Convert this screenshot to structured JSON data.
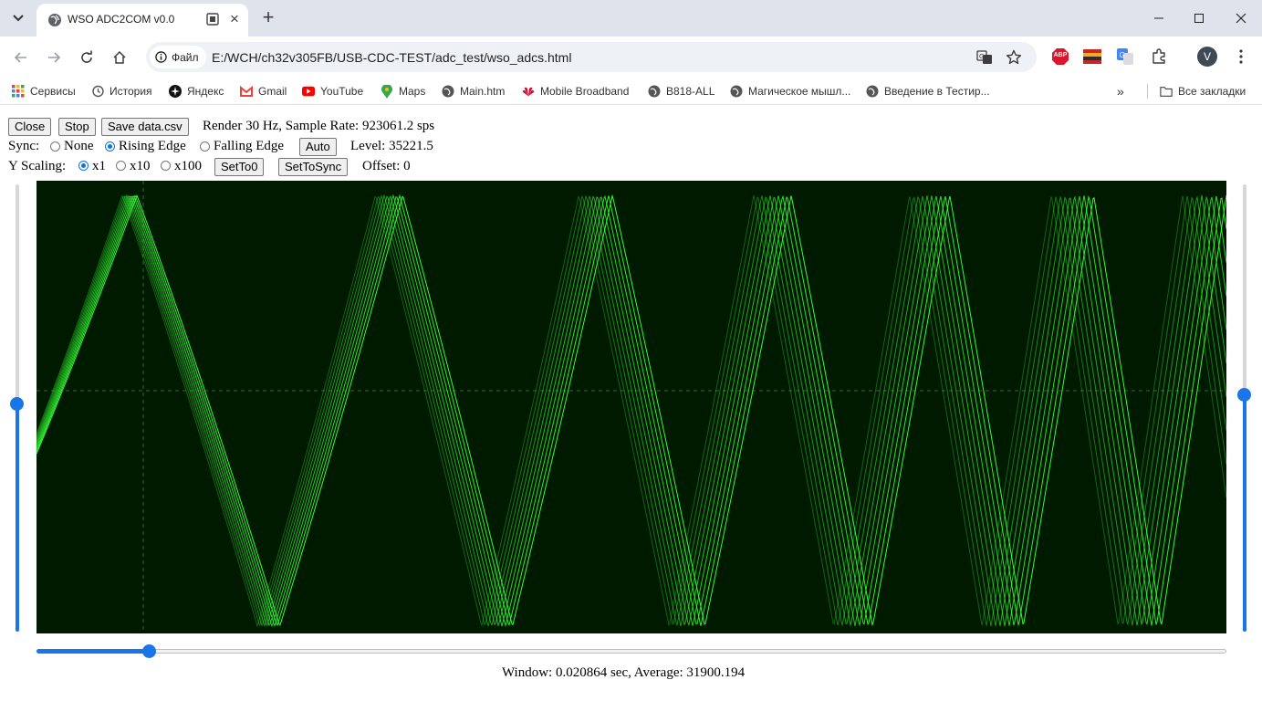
{
  "browser": {
    "tab_title": "WSO ADC2COM v0.0",
    "info_chip_label": "Файл",
    "url": "E:/WCH/ch32v305FB/USB-CDC-TEST/adc_test/wso_adcs.html",
    "profile_initial": "V",
    "abp_label": "ABP",
    "bookmarks": [
      {
        "label": "Сервисы"
      },
      {
        "label": "История"
      },
      {
        "label": "Яндекс"
      },
      {
        "label": "Gmail"
      },
      {
        "label": "YouTube"
      },
      {
        "label": "Maps"
      },
      {
        "label": "Main.htm"
      },
      {
        "label": "Mobile Broadband"
      },
      {
        "label": "B818-ALL"
      },
      {
        "label": "Магическое мышл..."
      },
      {
        "label": "Введение в Тестир..."
      }
    ],
    "all_bookmarks_label": "Все закладки"
  },
  "app": {
    "close_label": "Close",
    "stop_label": "Stop",
    "save_label": "Save data.csv",
    "render_info": "Render 30 Hz, Sample Rate: 923061.2 sps",
    "sync_label": "Sync:",
    "sync_none": "None",
    "sync_rising": "Rising Edge",
    "sync_falling": "Falling Edge",
    "sync_selected": "Rising Edge",
    "auto_label": "Auto",
    "level_text": "Level: 35221.5",
    "yscale_label": "Y Scaling:",
    "yscale_x1": "x1",
    "yscale_x10": "x10",
    "yscale_x100": "x100",
    "yscale_selected": "x1",
    "setto0_label": "SetTo0",
    "settosync_label": "SetToSync",
    "offset_text": "Offset: 0",
    "status_text": "Window: 0.020864 sec, Average: 31900.194"
  },
  "sliders": {
    "left_vertical_fraction": 0.51,
    "right_vertical_fraction": 0.53,
    "horizontal_fraction": 0.094
  },
  "colors": {
    "scope_bg": "#001a00",
    "trace": "#33ff33",
    "accent": "#1a76e8"
  }
}
